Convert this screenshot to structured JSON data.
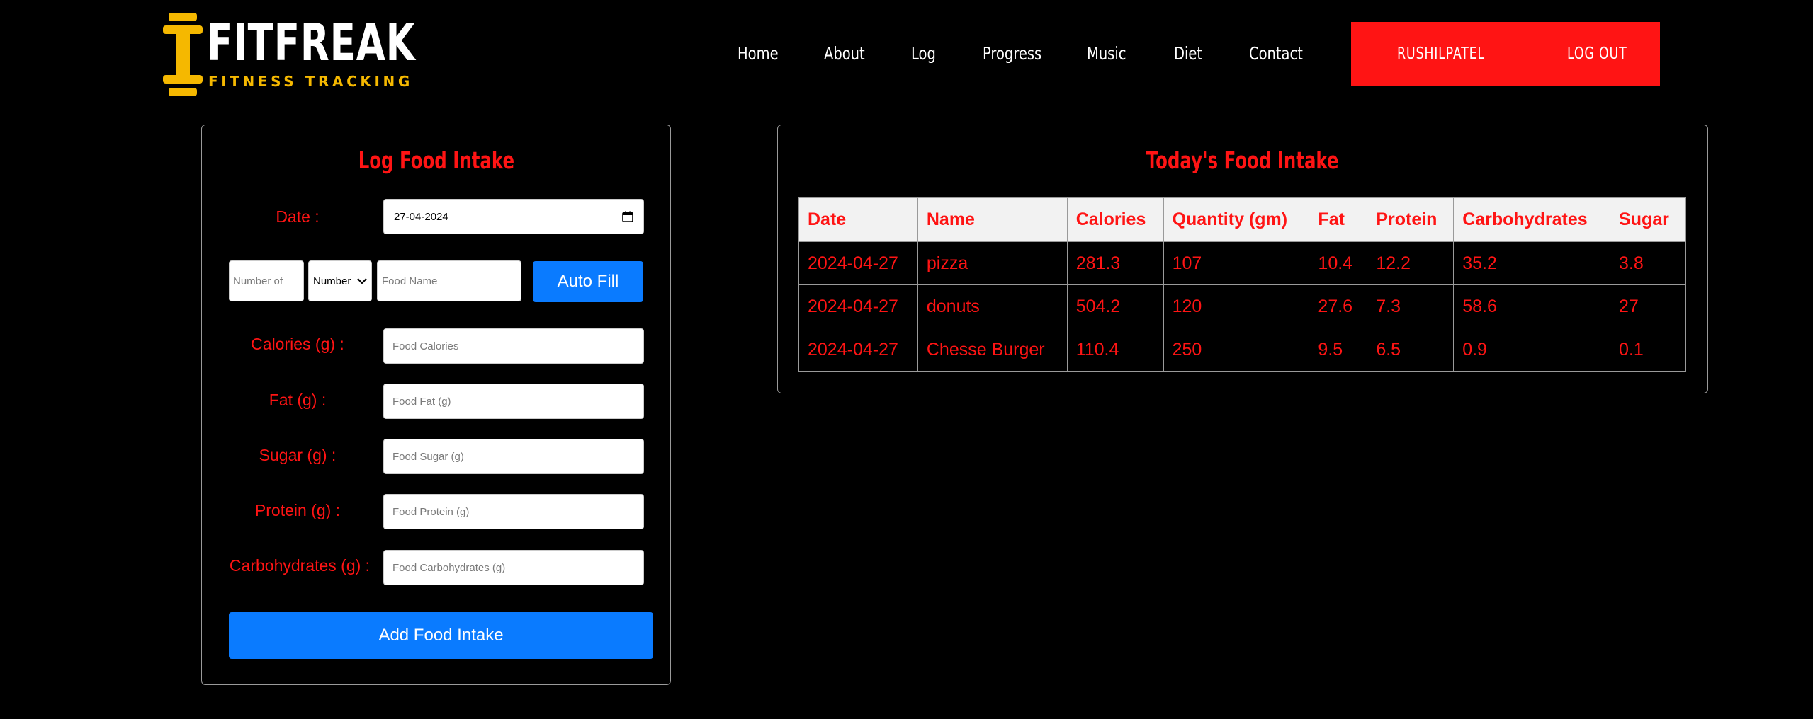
{
  "brand": {
    "title": "FITFREAK",
    "subtitle": "FITNESS TRACKING",
    "accent_color": "#f5b800",
    "logo_icon": "dumbbell-icon"
  },
  "nav": {
    "items": [
      {
        "label": "Home"
      },
      {
        "label": "About"
      },
      {
        "label": "Log"
      },
      {
        "label": "Progress"
      },
      {
        "label": "Music"
      },
      {
        "label": "Diet"
      },
      {
        "label": "Contact"
      }
    ],
    "username": "RUSHILPATEL",
    "logout": "LOG OUT",
    "highlight_color": "#ff1414"
  },
  "log_form": {
    "title": "Log Food Intake",
    "date_label": "Date :",
    "date_value": "27-04-2024",
    "number_of_placeholder": "Number of",
    "unit_select_value": "Number",
    "food_name_placeholder": "Food Name",
    "autofill_label": "Auto Fill",
    "calories_label": "Calories (g) :",
    "calories_placeholder": "Food Calories",
    "fat_label": "Fat (g) :",
    "fat_placeholder": "Food Fat (g)",
    "sugar_label": "Sugar (g) :",
    "sugar_placeholder": "Food Sugar (g)",
    "protein_label": "Protein (g) :",
    "protein_placeholder": "Food Protein (g)",
    "carbs_label": "Carbohydrates (g) :",
    "carbs_placeholder": "Food Carbohydrates (g)",
    "submit_label": "Add Food Intake",
    "button_color": "#0a7bff"
  },
  "intake_table": {
    "title": "Today's Food Intake",
    "columns": [
      "Date",
      "Name",
      "Calories",
      "Quantity (gm)",
      "Fat",
      "Protein",
      "Carbohydrates",
      "Sugar"
    ],
    "rows": [
      [
        "2024-04-27",
        "pizza",
        "281.3",
        "107",
        "10.4",
        "12.2",
        "35.2",
        "3.8"
      ],
      [
        "2024-04-27",
        "donuts",
        "504.2",
        "120",
        "27.6",
        "7.3",
        "58.6",
        "27"
      ],
      [
        "2024-04-27",
        "Chesse Burger",
        "110.4",
        "250",
        "9.5",
        "6.5",
        "0.9",
        "0.1"
      ]
    ]
  }
}
